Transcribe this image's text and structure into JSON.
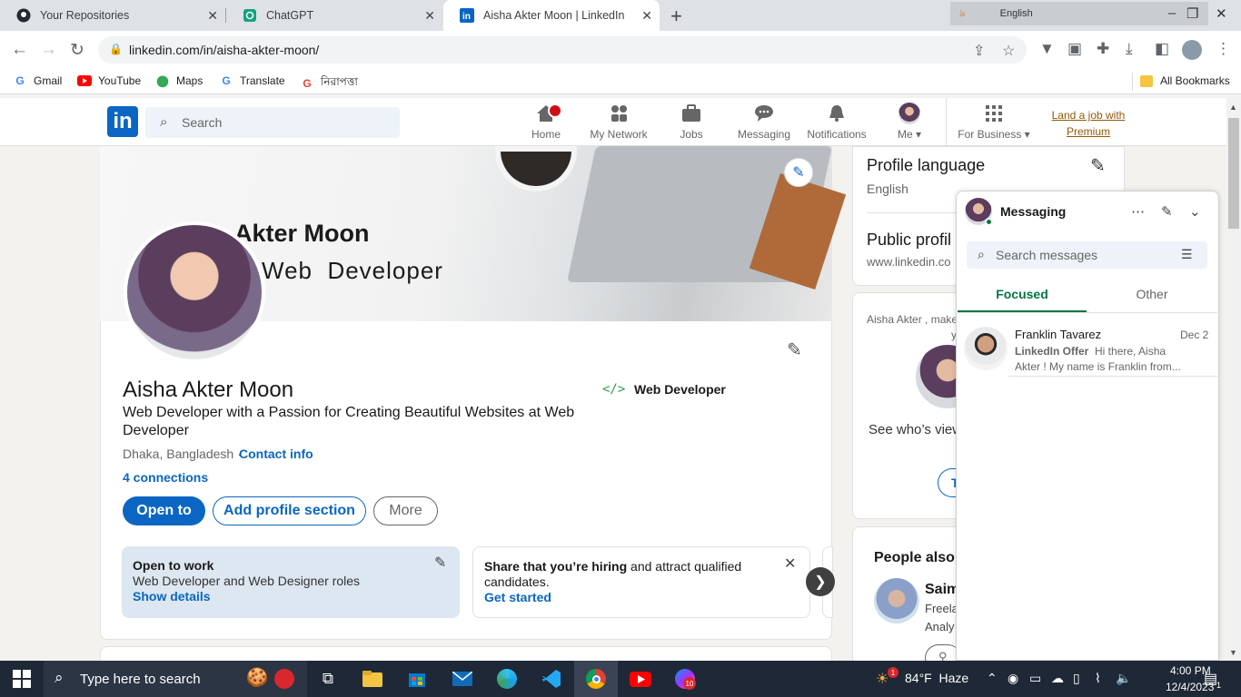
{
  "browser": {
    "tabs": [
      {
        "title": "Your Repositories",
        "icon": "github-icon"
      },
      {
        "title": "ChatGPT",
        "icon": "chatgpt-icon"
      },
      {
        "title": "Aisha Akter Moon | LinkedIn",
        "icon": "linkedin-icon"
      }
    ],
    "language_bar": "English",
    "url": "linkedin.com/in/aisha-akter-moon/",
    "bookmarks": [
      "Gmail",
      "YouTube",
      "Maps",
      "Translate",
      "নিরাপত্তা"
    ],
    "all_bookmarks": "All Bookmarks"
  },
  "linkedin_nav": {
    "search_placeholder": "Search",
    "items": [
      "Home",
      "My Network",
      "Jobs",
      "Messaging",
      "Notifications",
      "Me",
      "For Business"
    ],
    "premium_line1": "Land a job with",
    "premium_line2": "Premium"
  },
  "profile": {
    "cover_line1": "Akter Moon",
    "cover_line2": "Web  Developer",
    "name": "Aisha Akter Moon",
    "headline": "Web Developer with a Passion for Creating Beautiful Websites at Web Developer",
    "location": "Dhaka, Bangladesh ·",
    "contact_info": "Contact info",
    "connections": "4 connections",
    "current_position_icon": "</>",
    "current_position": "Web Developer",
    "buttons": {
      "open_to": "Open to",
      "add_section": "Add profile section",
      "more": "More"
    },
    "open_to_work": {
      "title": "Open to work",
      "roles": "Web Developer and Web Designer roles",
      "link": "Show details"
    },
    "hiring": {
      "bold": "Share that you’re hiring",
      "rest": " and attract qualified candidates.",
      "link": "Get started"
    }
  },
  "sidebar": {
    "profile_language_title": "Profile language",
    "profile_language_value": "English",
    "public_profile_title": "Public profil",
    "public_profile_url": "www.linkedin.co",
    "ad_text": "Aisha Akter , make",
    "ad_text_cut": "y",
    "see_who": "See who’s view",
    "ad_button": "T",
    "people_also_title": "People also v",
    "person_name": "Saim",
    "person_line1": "Freela",
    "person_line2": "Analy"
  },
  "messaging": {
    "title": "Messaging",
    "search_placeholder": "Search messages",
    "tab_focused": "Focused",
    "tab_other": "Other",
    "conversation": {
      "name": "Franklin Tavarez",
      "date": "Dec 2",
      "label": "LinkedIn Offer",
      "preview1": "Hi there, Aisha",
      "preview2": "Akter ! My name is Franklin from..."
    }
  },
  "taskbar": {
    "search_placeholder": "Type here to search",
    "weather": "84°F  Haze",
    "time": "4:00 PM",
    "date": "12/4/2023",
    "weather_badge": "1",
    "app_badge": "10",
    "notification_count": "1"
  },
  "colors": {
    "linkedin_blue": "#0a66c2",
    "focus_green": "#057642",
    "premium_gold": "#915907",
    "taskbar": "#1f2836"
  }
}
